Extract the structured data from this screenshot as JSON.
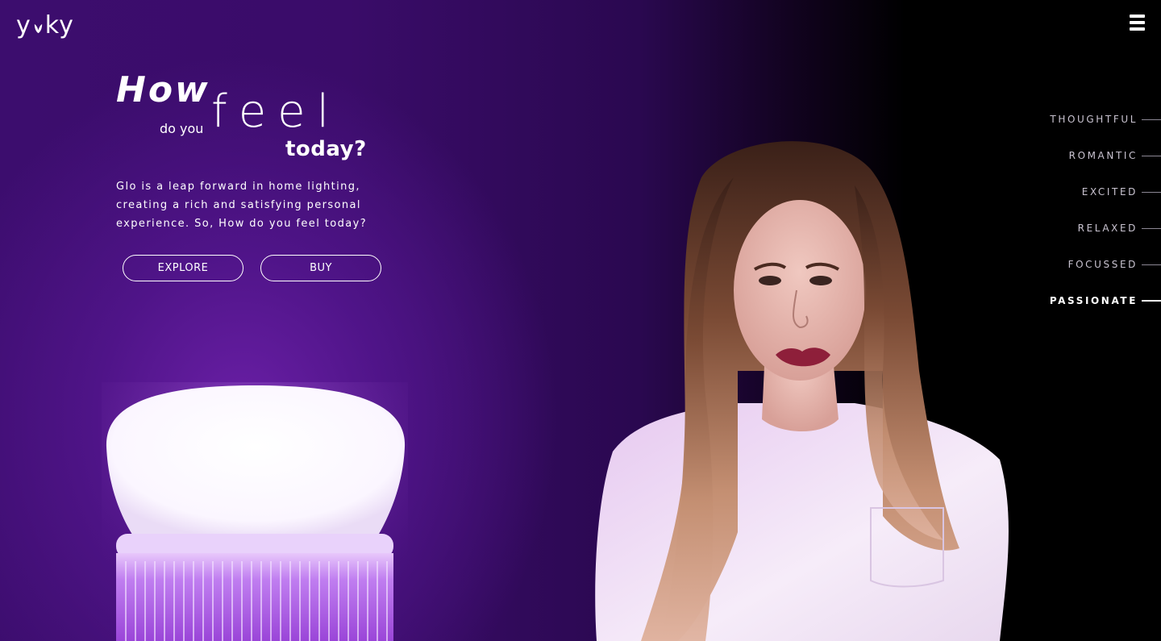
{
  "brand": {
    "logo_left": "y",
    "logo_right": "ky",
    "logo_icon": "leaf-icon"
  },
  "menu": {
    "icon": "hamburger-menu-icon"
  },
  "hero": {
    "headline_how": "How",
    "headline_do_you": "do you",
    "headline_feel": "feel",
    "headline_today": "today?",
    "description": "Glo is a leap forward in home lighting, creating a rich and satisfying personal experience. So, How do you feel today?",
    "explore_label": "EXPLORE",
    "buy_label": "BUY"
  },
  "moods": {
    "items": [
      {
        "label": "THOUGHTFUL",
        "active": false
      },
      {
        "label": "ROMANTIC",
        "active": false
      },
      {
        "label": "EXCITED",
        "active": false
      },
      {
        "label": "RELAXED",
        "active": false
      },
      {
        "label": "FOCUSSED",
        "active": false
      },
      {
        "label": "PASSIONATE",
        "active": true
      }
    ]
  },
  "colors": {
    "accent": "#6a1fa6",
    "background": "#000000",
    "text": "#ffffff"
  }
}
